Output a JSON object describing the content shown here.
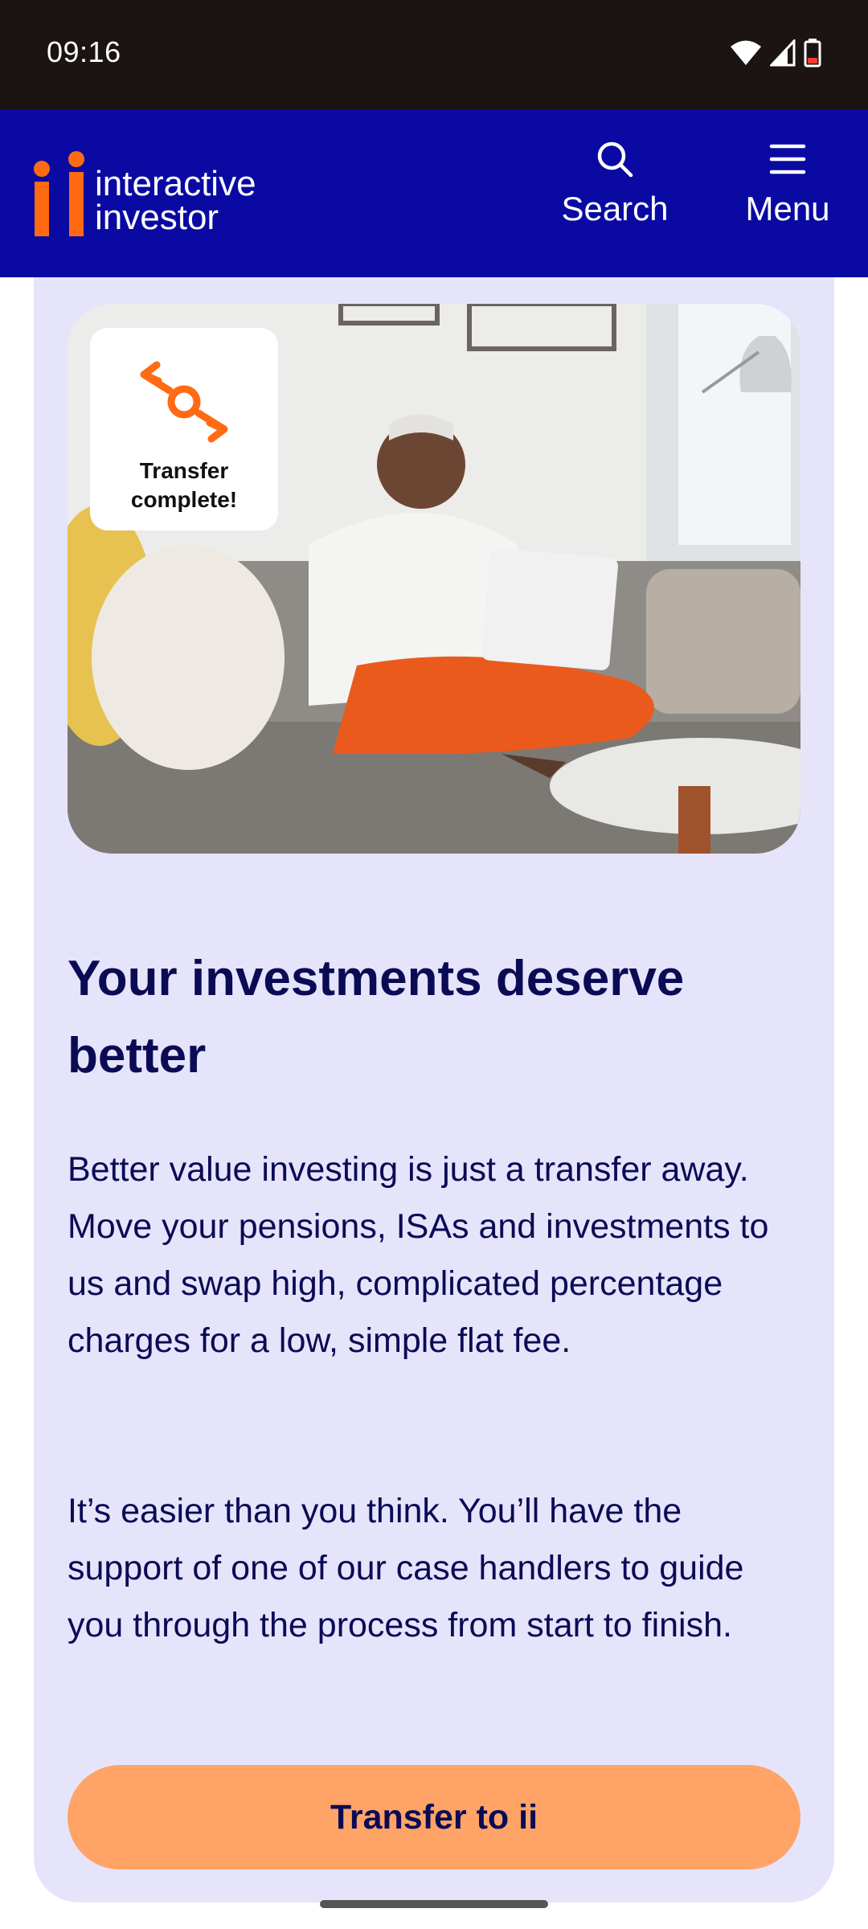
{
  "status_bar": {
    "time": "09:16",
    "icons": [
      "wifi-icon",
      "signal-icon",
      "battery-icon"
    ]
  },
  "header": {
    "logo_line1": "interactive",
    "logo_line2": "investor",
    "search_label": "Search",
    "menu_label": "Menu"
  },
  "hero": {
    "badge_line1": "Transfer",
    "badge_line2": "complete!"
  },
  "content": {
    "headline": "Your investments deserve better",
    "paragraph1": "Better value investing is just a transfer away. Move your pensions, ISAs and investments to us and swap high, complicated percentage charges for a low, simple flat fee.",
    "paragraph2": "It’s easier than you think. You’ll have the support of one of our case handlers to guide you through the process from start to finish.",
    "cta_label": "Transfer to ii"
  },
  "colors": {
    "header_bg": "#0a0aa3",
    "brand_orange": "#ff6a13",
    "card_bg": "#e6e4fb",
    "cta_bg": "#ffa466",
    "text_navy": "#0b0b55"
  }
}
